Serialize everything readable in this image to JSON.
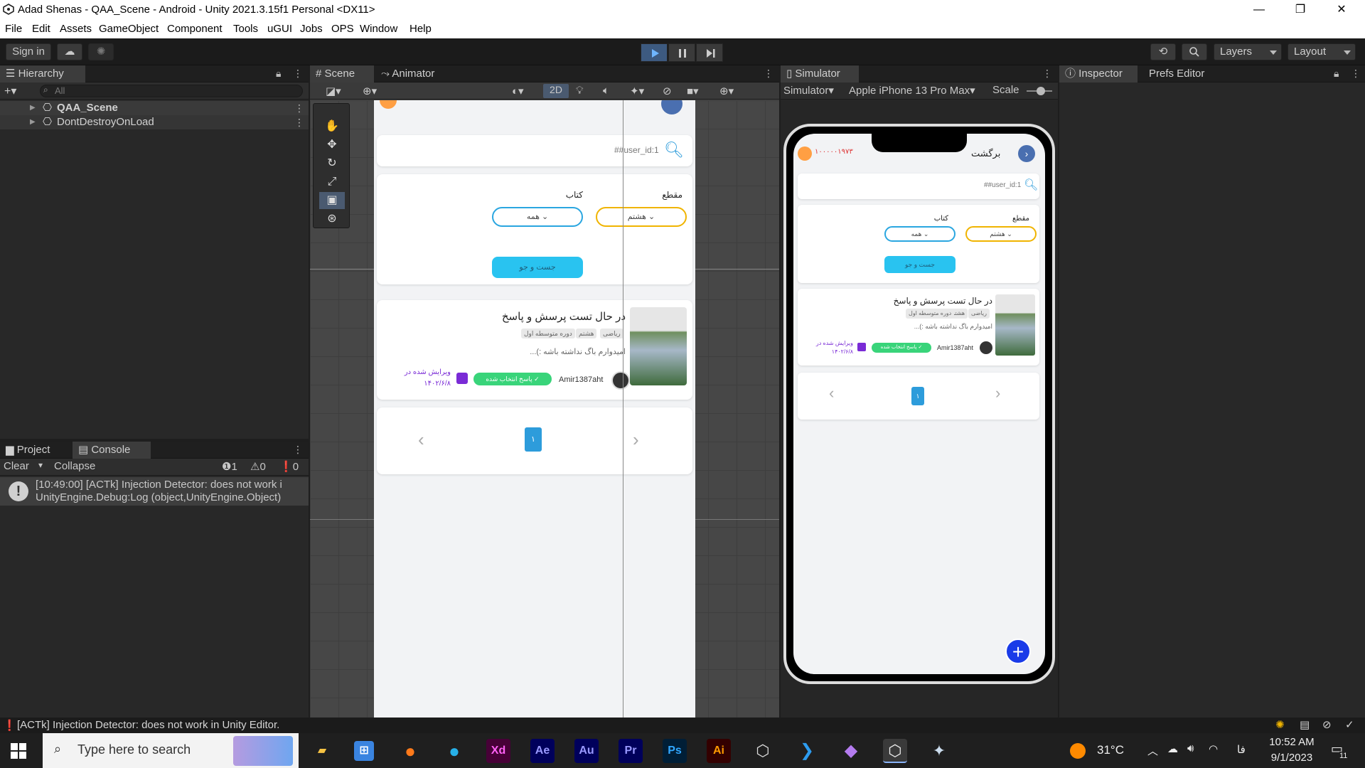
{
  "window": {
    "title": "Adad Shenas - QAA_Scene - Android - Unity 2021.3.15f1 Personal <DX11>",
    "minimize": "—",
    "maximize": "❐",
    "close": "✕"
  },
  "menu": [
    "File",
    "Edit",
    "Assets",
    "GameObject",
    "Component",
    "Tools",
    "uGUI",
    "Jobs",
    "OPS",
    "Window",
    "Help"
  ],
  "toolbar": {
    "sign_in": "Sign in",
    "layers": "Layers",
    "layout": "Layout"
  },
  "hierarchy": {
    "tab": "Hierarchy",
    "search_placeholder": "All",
    "items": [
      "QAA_Scene",
      "DontDestroyOnLoad"
    ]
  },
  "scene": {
    "tabs": [
      "Scene",
      "Animator"
    ],
    "mode_2d": "2D"
  },
  "simulator": {
    "tab": "Simulator",
    "mode": "Simulator",
    "device": "Apple iPhone 13 Pro Max",
    "scale_label": "Scale"
  },
  "inspector": {
    "tabs": [
      "Inspector",
      "Prefs Editor"
    ]
  },
  "console": {
    "tabs": [
      "Project",
      "Console"
    ],
    "clear": "Clear",
    "collapse": "Collapse",
    "count_log": "1",
    "count_warn": "0",
    "count_error": "0",
    "log_line1": "[10:49:00] [ACTk] Injection Detector: does not work i",
    "log_line2": "UnityEngine.Debug:Log (object,UnityEngine.Object)"
  },
  "app": {
    "back_label": "برگشت",
    "coins": "۱۰۰۰۰۰۱۹۷۳",
    "search_text": "##user_id:1",
    "label_grade": "مقطع",
    "label_book": "کتاب",
    "grade_value": "هشتم",
    "book_value": "همه",
    "search_button": "جست و جو",
    "question_title": "در حال تست پرسش و پاسخ",
    "tags": [
      "ریاضی",
      "هشتم",
      "دوره متوسطه اول"
    ],
    "question_excerpt": "امیدوارم باگ نداشته باشه :)...",
    "author": "Amir1387aht",
    "answered_badge": "پاسخ انتخاب شده",
    "edited_label": "ویرایش شده در",
    "edited_date": "۱۴۰۲/۶/۸",
    "page": "۱"
  },
  "statusbar": {
    "message": "[ACTk] Injection Detector: does not work in Unity Editor."
  },
  "taskbar": {
    "search_placeholder": "Type here to search",
    "temperature": "31°C",
    "lang": "فا",
    "time": "10:52 AM",
    "date": "9/1/2023",
    "notifications": "11",
    "apps": [
      "Xd",
      "Ae",
      "Au",
      "Pr",
      "Ps",
      "Ai"
    ]
  },
  "colors": {
    "accent_blue": "#2d9cdb",
    "search_btn": "#29c3f0",
    "grade_border": "#f0b400",
    "book_border": "#2aa6e0",
    "answered_green": "#39d47a",
    "edited_purple": "#7a2bd6",
    "fab_blue": "#1a3be8"
  }
}
